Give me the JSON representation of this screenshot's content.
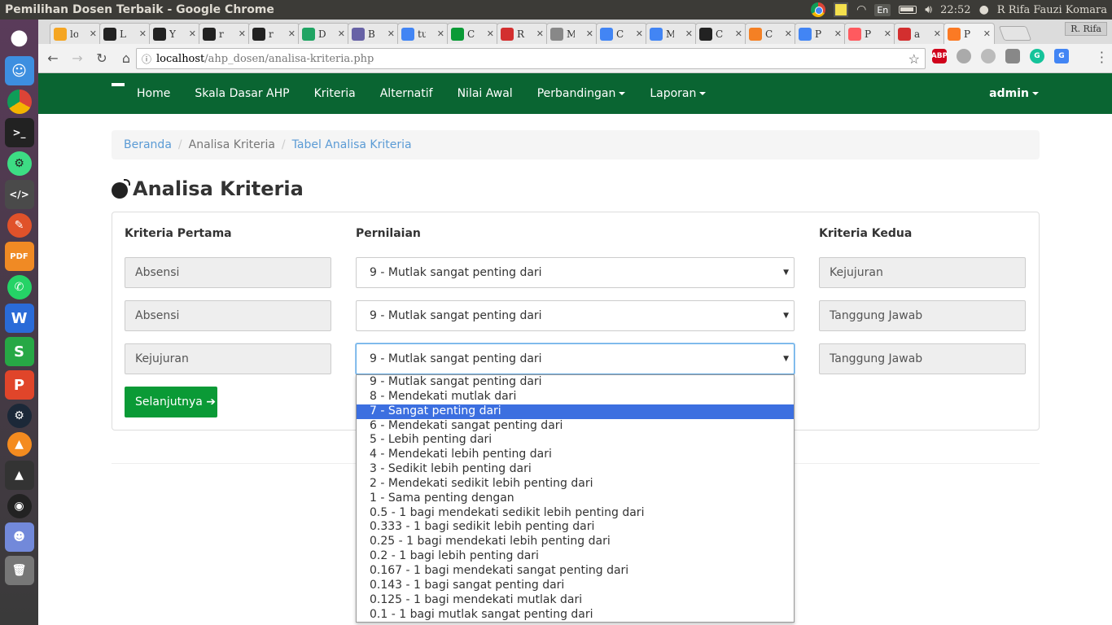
{
  "os": {
    "window_title": "Pemilihan Dosen Terbaik - Google Chrome",
    "lang": "En",
    "clock": "22:52",
    "user": "R Rifa Fauzi Komara"
  },
  "browser": {
    "profile": "R. Rifa",
    "tabs": [
      {
        "icon": "phpmyadmin-icon",
        "label": "lo",
        "color": "#f5a623"
      },
      {
        "icon": "bowtie-icon",
        "label": "L",
        "color": "#222222"
      },
      {
        "icon": "github-icon",
        "label": "Y",
        "color": "#222222"
      },
      {
        "icon": "github-icon",
        "label": "r",
        "color": "#222222"
      },
      {
        "icon": "github-icon",
        "label": "r",
        "color": "#222222"
      },
      {
        "icon": "google-drive-icon",
        "label": "D",
        "color": "#1fa463"
      },
      {
        "icon": "heroku-icon",
        "label": "B",
        "color": "#6762a6"
      },
      {
        "icon": "google-icon",
        "label": "tu",
        "color": "#4285f4"
      },
      {
        "icon": "android-icon",
        "label": "C",
        "color": "#0a9a36"
      },
      {
        "icon": "pn-icon",
        "label": "R",
        "color": "#d32f2f"
      },
      {
        "icon": "document-icon",
        "label": "M",
        "color": "#888888"
      },
      {
        "icon": "translate-icon",
        "label": "C",
        "color": "#4285f4"
      },
      {
        "icon": "google-icon",
        "label": "M",
        "color": "#4285f4"
      },
      {
        "icon": "github-icon",
        "label": "C",
        "color": "#222222"
      },
      {
        "icon": "stackoverflow-icon",
        "label": "C",
        "color": "#f48024"
      },
      {
        "icon": "google-icon",
        "label": "P",
        "color": "#4285f4"
      },
      {
        "icon": "airbnb-icon",
        "label": "P",
        "color": "#ff5a5f"
      },
      {
        "icon": "red-circle-icon",
        "label": "a",
        "color": "#d32f2f"
      },
      {
        "icon": "xampp-icon",
        "label": "P",
        "color": "#fb7a24"
      }
    ],
    "url_host": "localhost",
    "url_path": "/ahp_dosen/analisa-kriteria.php"
  },
  "navbar": {
    "links": [
      "Home",
      "Skala Dasar AHP",
      "Kriteria",
      "Alternatif",
      "Nilai Awal"
    ],
    "dropdown_links": [
      "Perbandingan",
      "Laporan"
    ],
    "user": "admin",
    "color": "#0a6532"
  },
  "breadcrumb": {
    "home": "Beranda",
    "current": "Analisa Kriteria",
    "next": "Tabel Analisa Kriteria"
  },
  "page": {
    "title": "Analisa Kriteria"
  },
  "form": {
    "col_first": "Kriteria Pertama",
    "col_rating": "Pernilaian",
    "col_second": "Kriteria Kedua",
    "rows": [
      {
        "first": "Absensi",
        "rating": "9 - Mutlak sangat penting dari",
        "second": "Kejujuran"
      },
      {
        "first": "Absensi",
        "rating": "9 - Mutlak sangat penting dari",
        "second": "Tanggung Jawab"
      },
      {
        "first": "Kejujuran",
        "rating": "9 - Mutlak sangat penting dari",
        "second": "Tanggung Jawab"
      }
    ],
    "next_button": "Selanjutnya ➔"
  },
  "dropdown": {
    "highlighted_index": 2,
    "options": [
      "9 - Mutlak sangat penting dari",
      "8 - Mendekati mutlak dari",
      "7 - Sangat penting dari",
      "6 - Mendekati sangat penting dari",
      "5 - Lebih penting dari",
      "4 - Mendekati lebih penting dari",
      "3 - Sedikit lebih penting dari",
      "2 - Mendekati sedikit lebih penting dari",
      "1 - Sama penting dengan",
      "0.5 - 1 bagi mendekati sedikit lebih penting dari",
      "0.333 - 1 bagi sedikit lebih penting dari",
      "0.25 - 1 bagi mendekati lebih penting dari",
      "0.2 - 1 bagi lebih penting dari",
      "0.167 - 1 bagi mendekati sangat penting dari",
      "0.143 - 1 bagi sangat penting dari",
      "0.125 - 1 bagi mendekati mutlak dari",
      "0.1 - 1 bagi mutlak sangat penting dari"
    ]
  }
}
